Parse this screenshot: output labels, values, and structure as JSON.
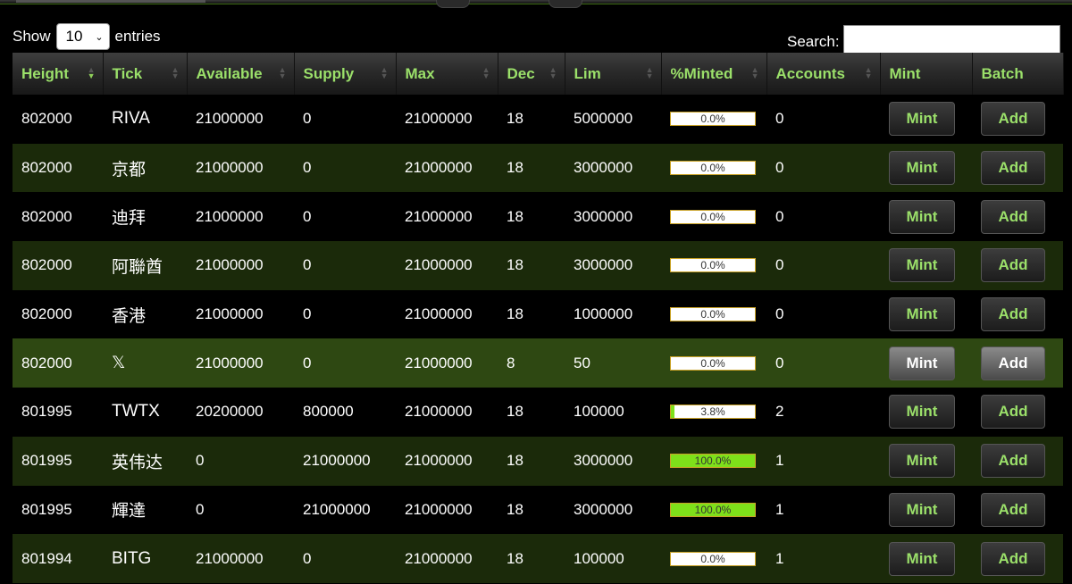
{
  "controls": {
    "show_label": "Show",
    "entries_value": "10",
    "entries_label": "entries",
    "search_label": "Search:",
    "search_value": ""
  },
  "columns": [
    "Height",
    "Tick",
    "Available",
    "Supply",
    "Max",
    "Dec",
    "Lim",
    "%Minted",
    "Accounts",
    "Mint",
    "Batch"
  ],
  "sorted_column": "Height",
  "rows": [
    {
      "height": "802000",
      "tick": "RIVA",
      "available": "21000000",
      "supply": "0",
      "max": "21000000",
      "dec": "18",
      "lim": "5000000",
      "minted": "0.0%",
      "minted_frac": 0,
      "accounts": "0",
      "mint": "Mint",
      "batch": "Add"
    },
    {
      "height": "802000",
      "tick": "京都",
      "available": "21000000",
      "supply": "0",
      "max": "21000000",
      "dec": "18",
      "lim": "3000000",
      "minted": "0.0%",
      "minted_frac": 0,
      "accounts": "0",
      "mint": "Mint",
      "batch": "Add"
    },
    {
      "height": "802000",
      "tick": "迪拜",
      "available": "21000000",
      "supply": "0",
      "max": "21000000",
      "dec": "18",
      "lim": "3000000",
      "minted": "0.0%",
      "minted_frac": 0,
      "accounts": "0",
      "mint": "Mint",
      "batch": "Add"
    },
    {
      "height": "802000",
      "tick": "阿聯酋",
      "available": "21000000",
      "supply": "0",
      "max": "21000000",
      "dec": "18",
      "lim": "3000000",
      "minted": "0.0%",
      "minted_frac": 0,
      "accounts": "0",
      "mint": "Mint",
      "batch": "Add"
    },
    {
      "height": "802000",
      "tick": "香港",
      "available": "21000000",
      "supply": "0",
      "max": "21000000",
      "dec": "18",
      "lim": "1000000",
      "minted": "0.0%",
      "minted_frac": 0,
      "accounts": "0",
      "mint": "Mint",
      "batch": "Add"
    },
    {
      "height": "802000",
      "tick": "𝕏",
      "available": "21000000",
      "supply": "0",
      "max": "21000000",
      "dec": "8",
      "lim": "50",
      "minted": "0.0%",
      "minted_frac": 0,
      "accounts": "0",
      "mint": "Mint",
      "batch": "Add",
      "highlight": true
    },
    {
      "height": "801995",
      "tick": "TWTX",
      "available": "20200000",
      "supply": "800000",
      "max": "21000000",
      "dec": "18",
      "lim": "100000",
      "minted": "3.8%",
      "minted_frac": 0.038,
      "accounts": "2",
      "mint": "Mint",
      "batch": "Add"
    },
    {
      "height": "801995",
      "tick": "英伟达",
      "available": "0",
      "supply": "21000000",
      "max": "21000000",
      "dec": "18",
      "lim": "3000000",
      "minted": "100.0%",
      "minted_frac": 1,
      "accounts": "1",
      "mint": "Mint",
      "batch": "Add"
    },
    {
      "height": "801995",
      "tick": "輝達",
      "available": "0",
      "supply": "21000000",
      "max": "21000000",
      "dec": "18",
      "lim": "3000000",
      "minted": "100.0%",
      "minted_frac": 1,
      "accounts": "1",
      "mint": "Mint",
      "batch": "Add"
    },
    {
      "height": "801994",
      "tick": "BITG",
      "available": "21000000",
      "supply": "0",
      "max": "21000000",
      "dec": "18",
      "lim": "100000",
      "minted": "0.0%",
      "minted_frac": 0,
      "accounts": "1",
      "mint": "Mint",
      "batch": "Add"
    }
  ]
}
